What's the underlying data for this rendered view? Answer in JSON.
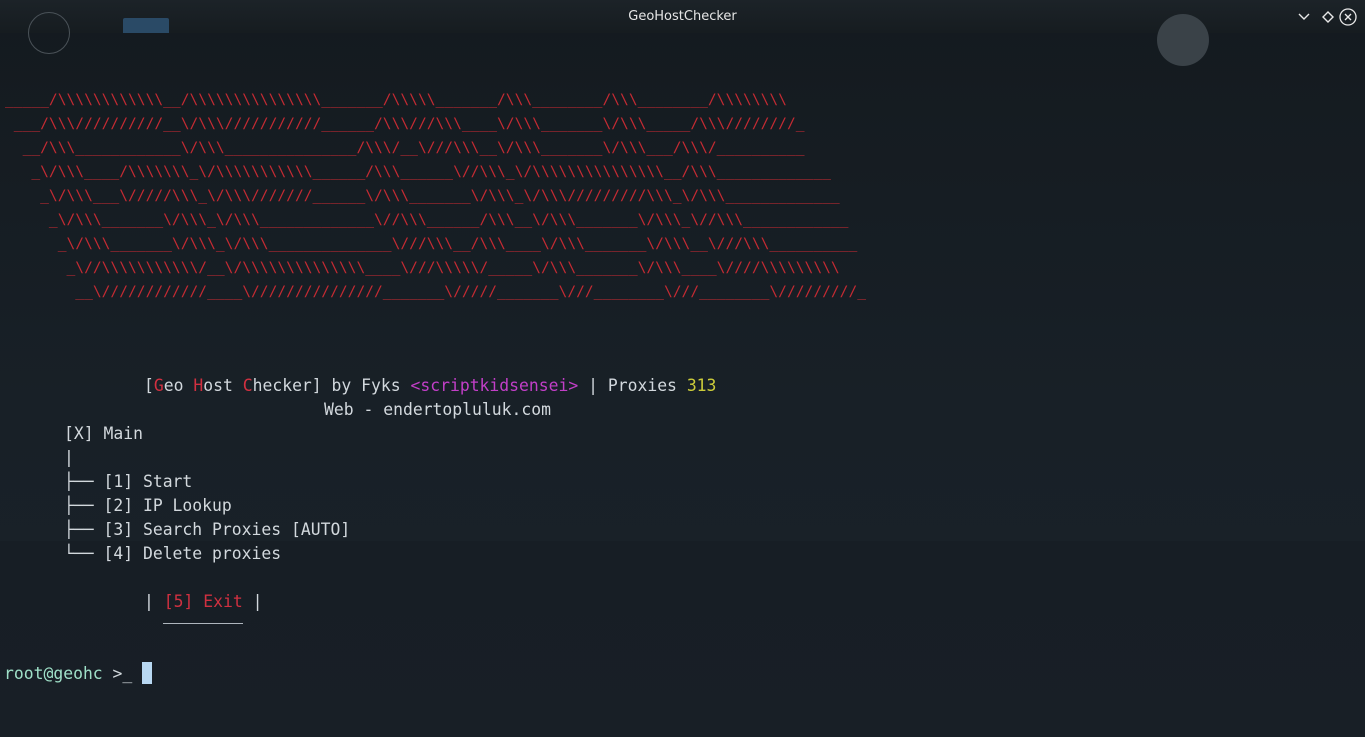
{
  "window": {
    "title": "GeoHostChecker"
  },
  "banner": {
    "lines": [
      "_____/\\\\\\\\\\\\\\\\\\\\\\\\__/\\\\\\\\\\\\\\\\\\\\\\\\\\\\\\_______/\\\\\\\\\\_______/\\\\\\________/\\\\\\________/\\\\\\\\\\\\\\\\",
      " ___/\\\\\\//////////__\\/\\\\\\///////////______/\\\\\\///\\\\\\____\\/\\\\\\_______\\/\\\\\\_____/\\\\\\////////_",
      "  __/\\\\\\____________\\/\\\\\\_______________/\\\\\\/__\\///\\\\\\__\\/\\\\\\_______\\/\\\\\\___/\\\\\\/__________",
      "   _\\/\\\\\\____/\\\\\\\\\\\\\\_\\/\\\\\\\\\\\\\\\\\\\\\\______/\\\\\\______\\//\\\\\\_\\/\\\\\\\\\\\\\\\\\\\\\\\\\\\\\\__/\\\\\\_____________",
      "    _\\/\\\\\\___\\/////\\\\\\_\\/\\\\\\///////______\\/\\\\\\_______\\/\\\\\\_\\/\\\\\\/////////\\\\\\_\\/\\\\\\_____________",
      "     _\\/\\\\\\_______\\/\\\\\\_\\/\\\\\\_____________\\//\\\\\\______/\\\\\\__\\/\\\\\\_______\\/\\\\\\_\\//\\\\\\____________",
      "      _\\/\\\\\\_______\\/\\\\\\_\\/\\\\\\______________\\///\\\\\\__/\\\\\\____\\/\\\\\\_______\\/\\\\\\__\\///\\\\\\__________",
      "       _\\//\\\\\\\\\\\\\\\\\\\\\\/__\\/\\\\\\\\\\\\\\\\\\\\\\\\\\\\____\\///\\\\\\\\\\/_____\\/\\\\\\_______\\/\\\\\\____\\////\\\\\\\\\\\\\\\\\\",
      "        __\\////////////____\\///////////////_______\\/////_______\\///________\\///________\\/////////_"
    ]
  },
  "header": {
    "open_bracket": "[",
    "geo_letter": "G",
    "geo_rest": "eo ",
    "host_letter": "H",
    "host_rest": "ost ",
    "checker_letter": "C",
    "checker_rest": "hecker]",
    "by_text": " by Fyks ",
    "handle": "<scriptkidsensei>",
    "proxies_text": " | Proxies ",
    "proxies_count": "313",
    "web_prefix": "Web - ",
    "web_url": "endertopluluk.com"
  },
  "menu": {
    "root": "[X] Main",
    "pipe": "|",
    "items": [
      {
        "branch": "├── ",
        "label": "[1] Start"
      },
      {
        "branch": "├── ",
        "label": "[2] IP Lookup"
      },
      {
        "branch": "├── ",
        "label": "[3] Search Proxies [AUTO]"
      },
      {
        "branch": "└── ",
        "label": "[4] Delete proxies"
      }
    ],
    "exit_left": "| ",
    "exit_label": "[5] Exit",
    "exit_right": " |"
  },
  "prompt": {
    "text": "root@geohc",
    "symbol": " >_ "
  },
  "colors": {
    "banner": "#c42b33",
    "accent_red": "#d03040",
    "handle": "#c23fc7",
    "count": "#cccc3a",
    "prompt": "#9fe0c8",
    "cursor": "#b8d8f2"
  }
}
